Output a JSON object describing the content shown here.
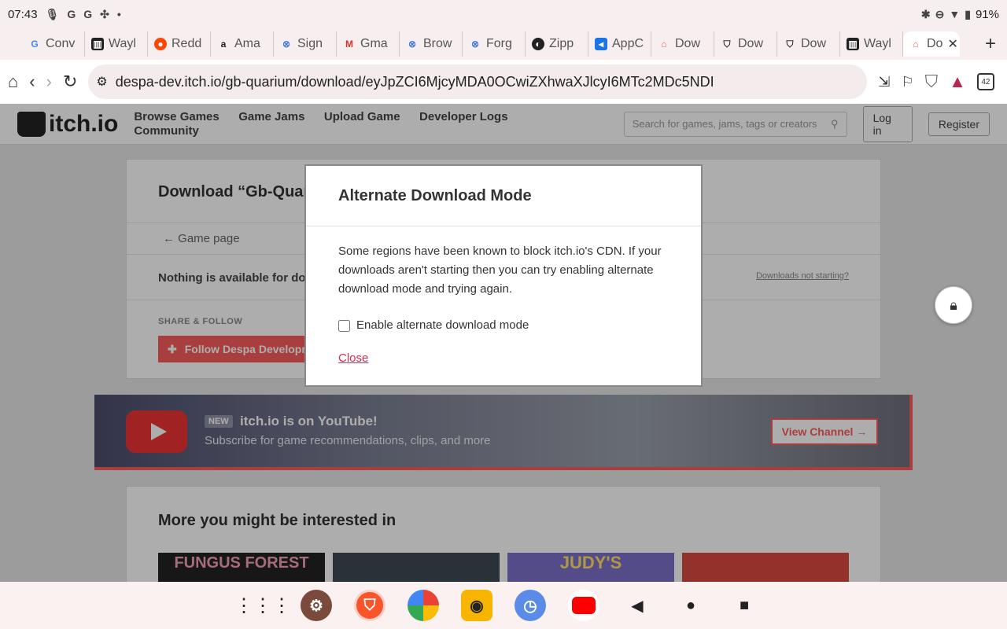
{
  "status_bar": {
    "time": "07:43",
    "left_icons": [
      "mic-icon",
      "G",
      "G",
      "slack-icon",
      "•"
    ],
    "battery": "91%"
  },
  "tabs": [
    {
      "label": "Conv",
      "icon": "google-icon"
    },
    {
      "label": "Wayl",
      "icon": "archive-icon"
    },
    {
      "label": "Redd",
      "icon": "reddit-icon"
    },
    {
      "label": "Ama",
      "icon": "amazon-icon"
    },
    {
      "label": "Sign",
      "icon": "site-icon"
    },
    {
      "label": "Gma",
      "icon": "gmail-icon"
    },
    {
      "label": "Brow",
      "icon": "site-icon"
    },
    {
      "label": "Forg",
      "icon": "site-icon"
    },
    {
      "label": "Zipp",
      "icon": "zippy-icon"
    },
    {
      "label": "AppC",
      "icon": "app-icon"
    },
    {
      "label": "Dow",
      "icon": "itch-icon"
    },
    {
      "label": "Dow",
      "icon": "brave-icon"
    },
    {
      "label": "Dow",
      "icon": "brave-icon"
    },
    {
      "label": "Wayl",
      "icon": "archive-icon"
    },
    {
      "label": "Do",
      "icon": "itch-icon",
      "active": true
    }
  ],
  "toolbar": {
    "url": "despa-dev.itch.io/gb-quarium/download/eyJpZCI6MjcyMDA0OCwiZXhwaXJlcyI6MTc2MDc5NDI",
    "tab_count": "42"
  },
  "site": {
    "logo_text": "itch.io",
    "nav": [
      "Browse Games",
      "Game Jams",
      "Upload Game",
      "Developer Logs",
      "Community"
    ],
    "search_placeholder": "Search for games, jams, tags or creators",
    "login": "Log in",
    "register": "Register"
  },
  "download_card": {
    "title": "Download “Gb-Quar",
    "game_page": "←  Game page",
    "nothing": "Nothing is available for do",
    "downloads_not_starting": "Downloads not starting?",
    "share_follow": "SHARE & FOLLOW",
    "follow_button": "Follow Despa Developm"
  },
  "youtube_banner": {
    "new_badge": "NEW",
    "title": "itch.io is on YouTube!",
    "subtitle": "Subscribe for game recommendations, clips, and more",
    "button": "View Channel →"
  },
  "more": {
    "title": "More you might be interested in",
    "thumb_texts": [
      "FUNGUS FOREST",
      "",
      "JUDY'S",
      ""
    ]
  },
  "modal": {
    "title": "Alternate Download Mode",
    "body": "Some regions have been known to block itch.io's CDN. If your downloads aren't starting then you can try enabling alternate download mode and trying again.",
    "checkbox_label": "Enable alternate download mode",
    "close": "Close"
  },
  "nav_bar": {
    "apps": [
      "app-drawer-icon",
      "settings-icon",
      "brave-icon",
      "photos-icon",
      "radio-icon",
      "clock-icon",
      "youtube-icon"
    ],
    "keys": [
      "back-icon",
      "home-icon",
      "recents-icon"
    ]
  }
}
